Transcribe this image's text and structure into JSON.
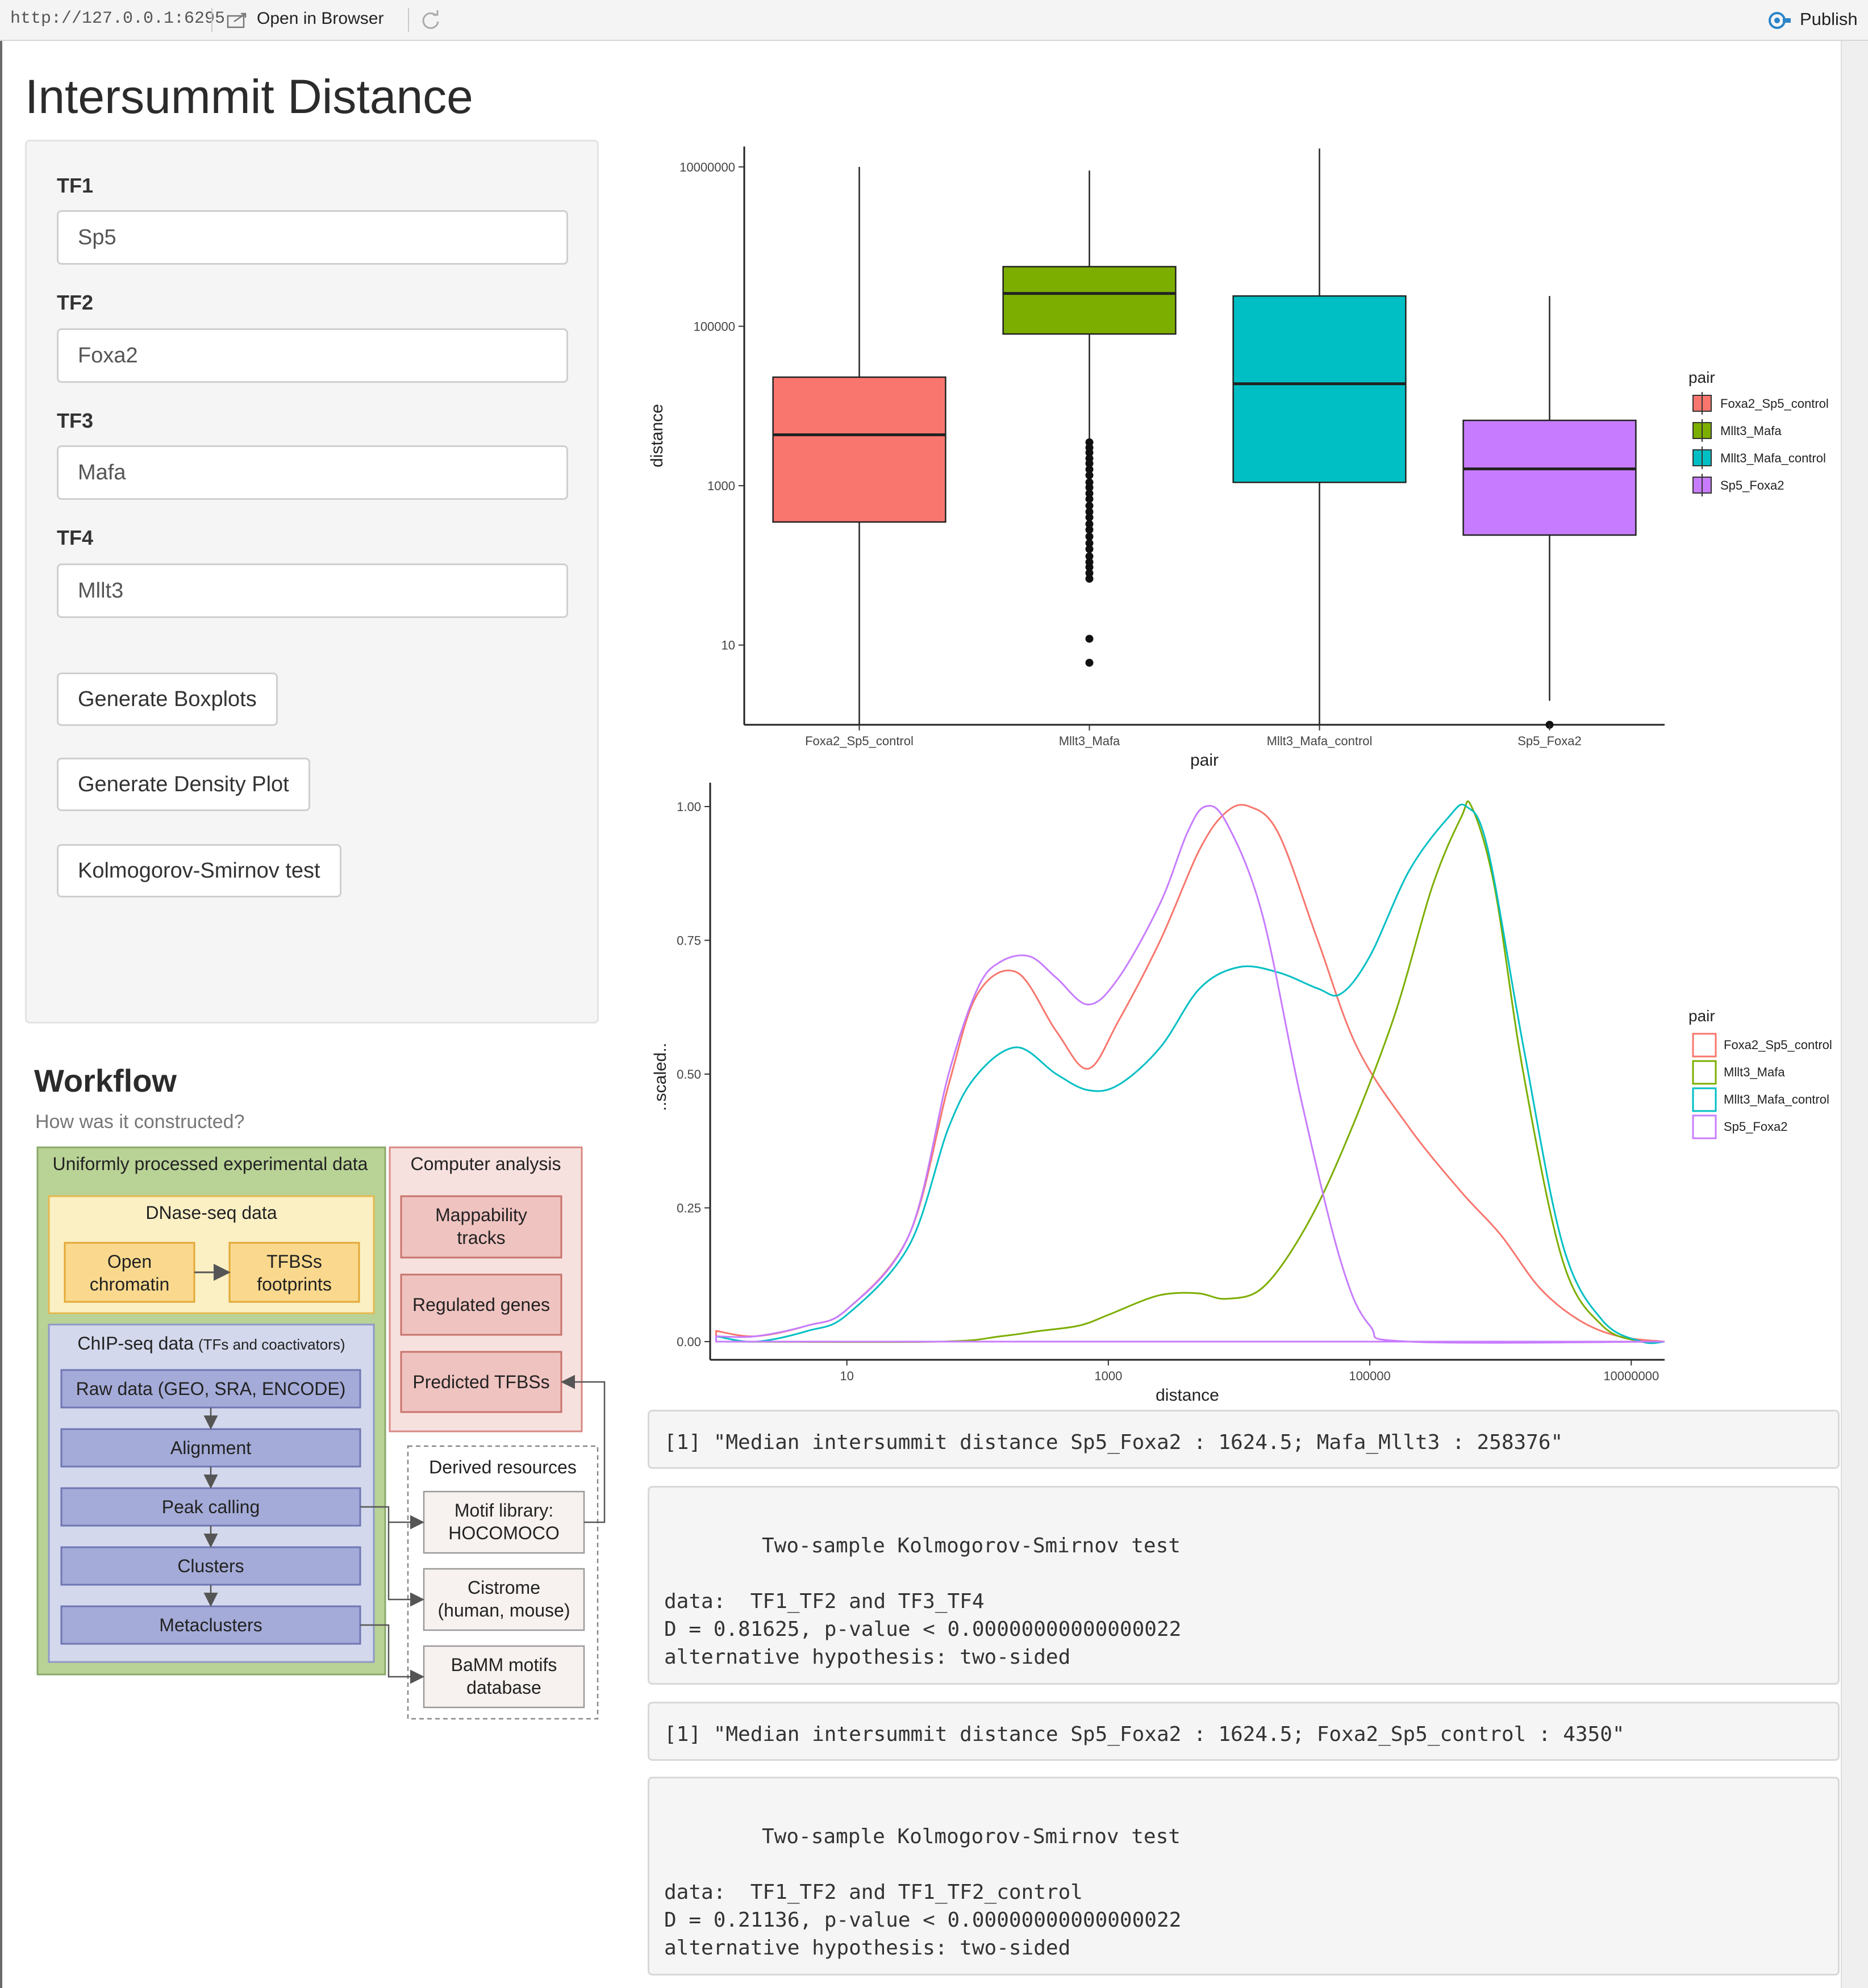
{
  "viewer": {
    "url": "http://127.0.0.1:6295",
    "open_label": "Open in Browser",
    "publish_label": "Publish"
  },
  "page": {
    "title": "Intersummit Distance"
  },
  "sidebar": {
    "inputs": [
      {
        "label": "TF1",
        "value": "Sp5"
      },
      {
        "label": "TF2",
        "value": "Foxa2"
      },
      {
        "label": "TF3",
        "value": "Mafa"
      },
      {
        "label": "TF4",
        "value": "Mllt3"
      }
    ],
    "buttons": [
      "Generate Boxplots",
      "Generate Density Plot",
      "Kolmogorov-Smirnov test"
    ]
  },
  "workflow": {
    "title": "Workflow",
    "subtitle": "How was it constructed?",
    "diagram": {
      "uniform_title": "Uniformly processed experimental data",
      "dnase_title": "DNase-seq data",
      "open_chromatin": [
        "Open",
        "chromatin"
      ],
      "tfbs_footprints": [
        "TFBSs",
        "footprints"
      ],
      "chip_title": "ChIP-seq data",
      "chip_note": "(TFs and coactivators)",
      "chip_steps": [
        "Raw data (GEO, SRA, ENCODE)",
        "Alignment",
        "Peak calling",
        "Clusters",
        "Metaclusters"
      ],
      "computer_title": "Computer analysis",
      "mappability": [
        "Mappability",
        "tracks"
      ],
      "regulated": "Regulated genes",
      "predicted": "Predicted TFBSs",
      "derived_title": "Derived resources",
      "motif_library": [
        "Motif library:",
        "HOCOMOCO"
      ],
      "cistrome": [
        "Cistrome",
        "(human, mouse)"
      ],
      "bamm": [
        "BaMM motifs",
        "database"
      ]
    }
  },
  "colors": {
    "Foxa2_Sp5_control": "#F8766D",
    "Mllt3_Mafa": "#7CAE00",
    "Mllt3_Mafa_control": "#00BFC4",
    "Sp5_Foxa2": "#C77CFF"
  },
  "chart_data": [
    {
      "type": "boxplot",
      "xlabel": "pair",
      "ylabel": "distance",
      "yscale": "log10",
      "ylim": [
        1,
        18000000
      ],
      "yticks": [
        10,
        1000,
        100000,
        10000000
      ],
      "ytick_labels": [
        "10",
        "1000",
        "100000",
        "10000000"
      ],
      "legend": {
        "title": "pair",
        "position": "right"
      },
      "categories": [
        "Foxa2_Sp5_control",
        "Mllt3_Mafa",
        "Mllt3_Mafa_control",
        "Sp5_Foxa2"
      ],
      "boxes": [
        {
          "name": "Foxa2_Sp5_control",
          "lower_whisker": 1,
          "q1": 350,
          "median": 4350,
          "q3": 23000,
          "upper_whisker": 10000000,
          "outliers": []
        },
        {
          "name": "Mllt3_Mafa",
          "lower_whisker": 3500,
          "q1": 80000,
          "median": 258376,
          "q3": 560000,
          "upper_whisker": 9000000,
          "outliers": [
            3500,
            3000,
            2600,
            2200,
            1900,
            1600,
            1350,
            1100,
            950,
            800,
            680,
            560,
            470,
            400,
            330,
            280,
            230,
            190,
            160,
            130,
            110,
            95,
            80,
            68,
            12,
            6
          ]
        },
        {
          "name": "Mllt3_Mafa_control",
          "lower_whisker": 1,
          "q1": 1100,
          "median": 19000,
          "q3": 240000,
          "upper_whisker": 17000000,
          "outliers": []
        },
        {
          "name": "Sp5_Foxa2",
          "lower_whisker": 2,
          "q1": 240,
          "median": 1624.5,
          "q3": 6600,
          "upper_whisker": 240000,
          "outliers": [
            1
          ]
        }
      ]
    },
    {
      "type": "line",
      "xlabel": "distance",
      "ylabel": "..scaled..",
      "xscale": "log10",
      "xlim": [
        0.9,
        18000000
      ],
      "xticks": [
        10,
        1000,
        100000,
        10000000
      ],
      "xtick_labels": [
        "10",
        "1000",
        "100000",
        "10000000"
      ],
      "ylim": [
        0,
        1.0
      ],
      "yticks": [
        0,
        0.25,
        0.5,
        0.75,
        1.0
      ],
      "ytick_labels": [
        "0.00",
        "0.25",
        "0.50",
        "0.75",
        "1.00"
      ],
      "legend": {
        "title": "pair",
        "position": "right"
      },
      "series": [
        {
          "name": "Foxa2_Sp5_control",
          "points": [
            [
              1,
              0.02
            ],
            [
              2,
              0.01
            ],
            [
              5,
              0.03
            ],
            [
              10,
              0.06
            ],
            [
              30,
              0.2
            ],
            [
              60,
              0.48
            ],
            [
              100,
              0.65
            ],
            [
              200,
              0.69
            ],
            [
              400,
              0.58
            ],
            [
              700,
              0.51
            ],
            [
              1200,
              0.6
            ],
            [
              2500,
              0.75
            ],
            [
              5000,
              0.92
            ],
            [
              8000,
              0.99
            ],
            [
              12000,
              1.0
            ],
            [
              20000,
              0.95
            ],
            [
              40000,
              0.75
            ],
            [
              80000,
              0.55
            ],
            [
              200000,
              0.4
            ],
            [
              500000,
              0.28
            ],
            [
              1000000,
              0.2
            ],
            [
              2000000,
              0.1
            ],
            [
              4000000,
              0.04
            ],
            [
              8000000,
              0.01
            ],
            [
              18000000,
              0.0
            ]
          ]
        },
        {
          "name": "Mllt3_Mafa",
          "points": [
            [
              1,
              0.0
            ],
            [
              50,
              0.0
            ],
            [
              150,
              0.01
            ],
            [
              300,
              0.02
            ],
            [
              600,
              0.03
            ],
            [
              1000,
              0.05
            ],
            [
              2000,
              0.08
            ],
            [
              3000,
              0.09
            ],
            [
              5000,
              0.09
            ],
            [
              8000,
              0.08
            ],
            [
              15000,
              0.1
            ],
            [
              30000,
              0.2
            ],
            [
              60000,
              0.35
            ],
            [
              150000,
              0.6
            ],
            [
              300000,
              0.85
            ],
            [
              500000,
              0.98
            ],
            [
              600000,
              1.0
            ],
            [
              900000,
              0.85
            ],
            [
              1500000,
              0.5
            ],
            [
              3000000,
              0.15
            ],
            [
              6000000,
              0.03
            ],
            [
              12000000,
              0.0
            ],
            [
              18000000,
              0.0
            ]
          ]
        },
        {
          "name": "Mllt3_Mafa_control",
          "points": [
            [
              1,
              0.01
            ],
            [
              2,
              0.0
            ],
            [
              5,
              0.02
            ],
            [
              10,
              0.05
            ],
            [
              30,
              0.18
            ],
            [
              60,
              0.4
            ],
            [
              100,
              0.5
            ],
            [
              200,
              0.55
            ],
            [
              400,
              0.5
            ],
            [
              700,
              0.47
            ],
            [
              1200,
              0.48
            ],
            [
              2500,
              0.55
            ],
            [
              5000,
              0.66
            ],
            [
              10000,
              0.7
            ],
            [
              20000,
              0.69
            ],
            [
              40000,
              0.66
            ],
            [
              60000,
              0.65
            ],
            [
              100000,
              0.72
            ],
            [
              200000,
              0.88
            ],
            [
              400000,
              0.98
            ],
            [
              550000,
              1.0
            ],
            [
              800000,
              0.92
            ],
            [
              1500000,
              0.55
            ],
            [
              3000000,
              0.18
            ],
            [
              6000000,
              0.04
            ],
            [
              12000000,
              0.0
            ],
            [
              18000000,
              0.0
            ]
          ]
        },
        {
          "name": "Sp5_Foxa2",
          "points": [
            [
              1,
              0.01
            ],
            [
              2,
              0.01
            ],
            [
              5,
              0.03
            ],
            [
              10,
              0.06
            ],
            [
              30,
              0.2
            ],
            [
              60,
              0.5
            ],
            [
              100,
              0.66
            ],
            [
              150,
              0.71
            ],
            [
              250,
              0.72
            ],
            [
              400,
              0.68
            ],
            [
              700,
              0.63
            ],
            [
              1200,
              0.68
            ],
            [
              2500,
              0.82
            ],
            [
              4000,
              0.95
            ],
            [
              5500,
              1.0
            ],
            [
              8000,
              0.97
            ],
            [
              15000,
              0.8
            ],
            [
              30000,
              0.45
            ],
            [
              60000,
              0.15
            ],
            [
              100000,
              0.03
            ],
            [
              200000,
              0.0
            ],
            [
              18000000,
              0.0
            ]
          ]
        }
      ]
    }
  ],
  "console": {
    "out1": "[1] \"Median intersummit distance Sp5_Foxa2 : 1624.5; Mafa_Mllt3 : 258376\"",
    "ks1": {
      "header": "Two-sample Kolmogorov-Smirnov test",
      "data": "data:  TF1_TF2 and TF3_TF4",
      "stat": "D = 0.81625, p-value < 0.00000000000000022",
      "alt": "alternative hypothesis: two-sided"
    },
    "out2": "[1] \"Median intersummit distance Sp5_Foxa2 : 1624.5; Foxa2_Sp5_control : 4350\"",
    "ks2": {
      "header": "Two-sample Kolmogorov-Smirnov test",
      "data": "data:  TF1_TF2 and TF1_TF2_control",
      "stat": "D = 0.21136, p-value < 0.00000000000000022",
      "alt": "alternative hypothesis: two-sided"
    }
  }
}
